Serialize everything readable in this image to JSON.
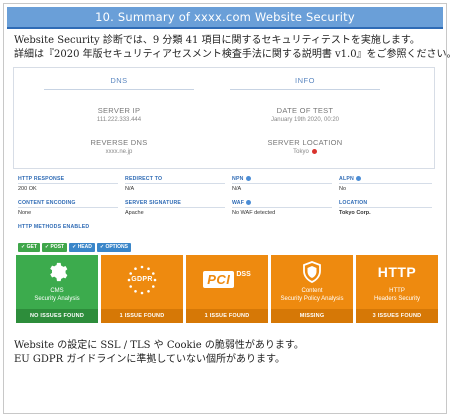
{
  "banner": {
    "title": "10. Summary of xxxx.com Website Security"
  },
  "intro": {
    "line1": "Website Security 診断では、9 分類 41 項目に関するセキュリティテストを実施します。",
    "line2": "詳細は『2020 年版セキュリティアセスメント検査手法に関する説明書 v1.0』をご参照ください。"
  },
  "dns": {
    "header": "DNS",
    "server_ip_label": "SERVER IP",
    "server_ip_value": "111.222.333.444",
    "reverse_dns_label": "REVERSE DNS",
    "reverse_dns_value": "xxxx.ne.jp"
  },
  "info": {
    "header": "INFO",
    "date_label": "DATE OF TEST",
    "date_value": "January 19th 2020, 00:20",
    "location_label": "SERVER LOCATION",
    "location_value": "Tokyo"
  },
  "details": {
    "row1": [
      {
        "key": "HTTP RESPONSE",
        "value": "200 OK"
      },
      {
        "key": "REDIRECT TO",
        "value": "N/A"
      },
      {
        "key": "NPN",
        "value": "N/A"
      },
      {
        "key": "ALPN",
        "value": "No"
      }
    ],
    "row2": [
      {
        "key": "CONTENT ENCODING",
        "value": "None"
      },
      {
        "key": "SERVER SIGNATURE",
        "value": "Apache"
      },
      {
        "key": "WAF",
        "value": "No WAF detected"
      },
      {
        "key": "LOCATION",
        "value": "Tokyo Corp."
      }
    ]
  },
  "methods": {
    "header": "HTTP METHODS ENABLED",
    "items": [
      "GET",
      "POST",
      "HEAD",
      "OPTIONS"
    ]
  },
  "tiles": [
    {
      "icon": "gear-icon",
      "title1": "CMS",
      "title2": "Security Analysis",
      "status": "NO ISSUES FOUND",
      "color": "#3cab4d"
    },
    {
      "icon": "gdpr-stars-icon",
      "label": "GDPR",
      "status": "1 ISSUE FOUND",
      "color": "#ee8a0f"
    },
    {
      "icon": "pci-dss-icon",
      "label_pci": "PCI",
      "label_dss": "DSS",
      "status": "1 ISSUE FOUND",
      "color": "#ee8a0f"
    },
    {
      "icon": "shield-icon",
      "title1": "Content",
      "title2": "Security Policy Analysis",
      "status": "MISSING",
      "color": "#ee8a0f"
    },
    {
      "label": "HTTP",
      "title1": "HTTP",
      "title2": "Headers Security",
      "status": "3 ISSUES FOUND",
      "color": "#ee8a0f"
    }
  ],
  "outro": {
    "line1": "Website の設定に SSL / TLS や Cookie の脆弱性があります。",
    "line2": "EU GDPR ガイドラインに準拠していない個所があります。"
  }
}
